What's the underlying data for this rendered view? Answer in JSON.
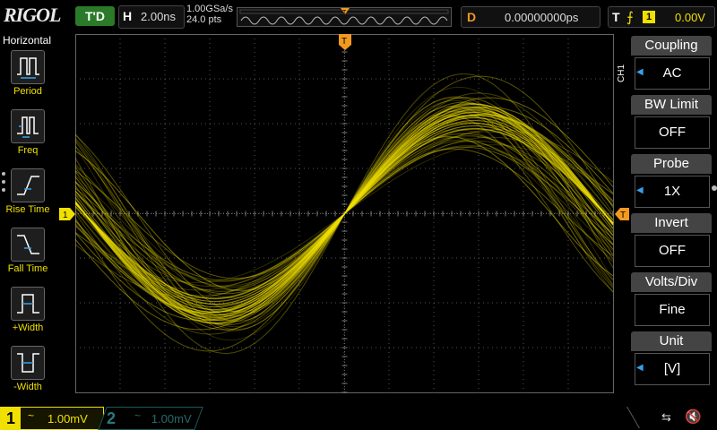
{
  "brand": {
    "logo": "RIGOL"
  },
  "status": {
    "run_state": "T'D"
  },
  "timebase": {
    "label": "H",
    "value": "2.00ns"
  },
  "acquisition": {
    "sample_rate": "1.00GSa/s",
    "points": "24.0 pts"
  },
  "trigger_marker": {
    "label": "T"
  },
  "delay": {
    "label": "D",
    "value": "0.00000000ps"
  },
  "trigger": {
    "label": "T",
    "edge": "⨍",
    "source": "1",
    "level": "0.00V"
  },
  "left_panel": {
    "title": "Horizontal",
    "buttons": [
      {
        "label": "Period"
      },
      {
        "label": "Freq"
      },
      {
        "label": "Rise Time"
      },
      {
        "label": "Fall Time"
      },
      {
        "label": "+Width"
      },
      {
        "label": "-Width"
      }
    ]
  },
  "right_menu": {
    "channel_tag": "CH1",
    "items": [
      {
        "title": "Coupling",
        "value": "AC"
      },
      {
        "title": "BW Limit",
        "value": "OFF"
      },
      {
        "title": "Probe",
        "value": "1X"
      },
      {
        "title": "Invert",
        "value": "OFF"
      },
      {
        "title": "Volts/Div",
        "value": "Fine"
      },
      {
        "title": "Unit",
        "value": "[V]"
      }
    ]
  },
  "markers": {
    "ch1_ground": "1",
    "trigger_level": "T"
  },
  "bottom": {
    "ch1": {
      "num": "1",
      "coupling": "~",
      "scale": "1.00mV"
    },
    "ch2": {
      "num": "2",
      "coupling": "~",
      "scale": "1.00mV"
    },
    "usb": "⇆",
    "speaker": "🔇"
  },
  "colors": {
    "ch1": "#f0e000",
    "ch2": "#1a6a6a",
    "accent": "#f39a1e",
    "menu_arrow": "#3aa0e8"
  },
  "waveform": {
    "type": "sine-persistence",
    "cycles": 1,
    "traces": 46
  }
}
